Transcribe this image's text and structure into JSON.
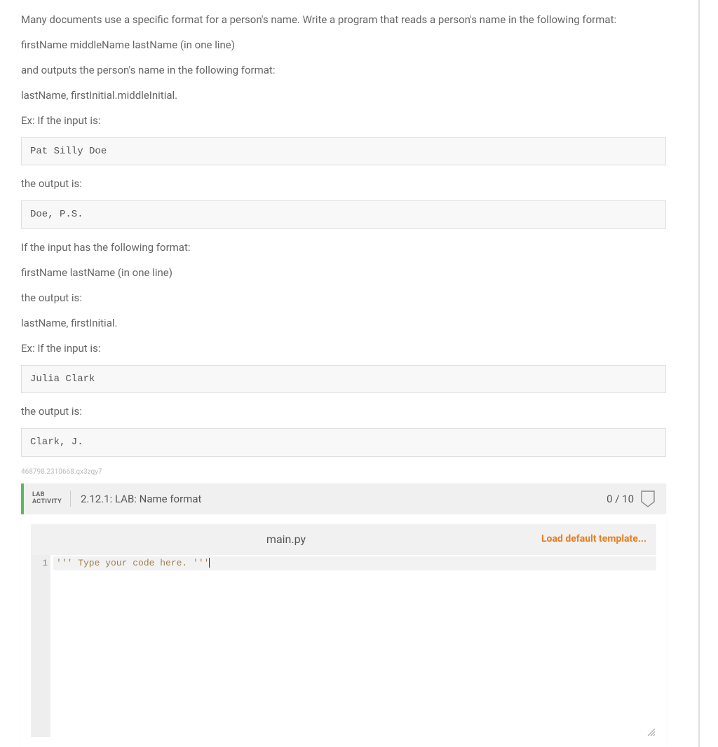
{
  "prompt": {
    "p1": "Many documents use a specific format for a person's name. Write a program that reads a person's name in the following format:",
    "p2": "firstName middleName lastName (in one line)",
    "p3": "and outputs the person's name in the following format:",
    "p4": "lastName, firstInitial.middleInitial.",
    "p5": "Ex: If the input is:",
    "code1": "Pat Silly Doe",
    "p6": "the output is:",
    "code2": "Doe, P.S.",
    "p7": "If the input has the following format:",
    "p8": "firstName lastName (in one line)",
    "p9": "the output is:",
    "p10": "lastName, firstInitial.",
    "p11": "Ex: If the input is:",
    "code3": "Julia Clark",
    "p12": "the output is:",
    "code4": "Clark, J."
  },
  "ref_code": "468798.2310668.qx3zqy7",
  "lab": {
    "badge_line1": "LAB",
    "badge_line2": "ACTIVITY",
    "title": "2.12.1: LAB: Name format",
    "score": "0 / 10"
  },
  "editor": {
    "filename": "main.py",
    "load_template_label": "Load default template...",
    "line_number": "1",
    "code_line1": "''' Type your code here. '''"
  }
}
